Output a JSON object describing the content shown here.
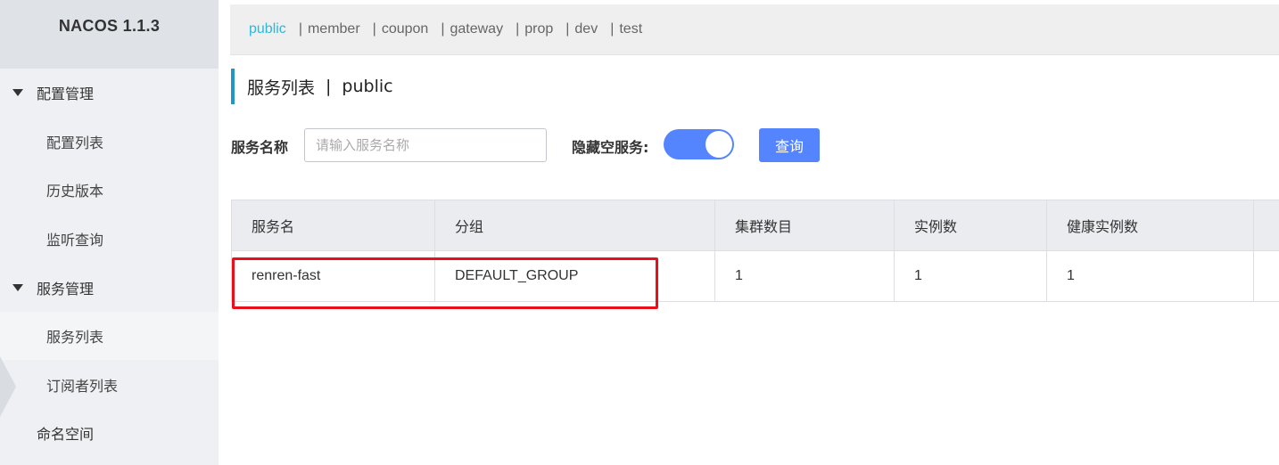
{
  "brand": {
    "title": "NACOS 1.1.3"
  },
  "sidebar": {
    "groups": [
      {
        "label": "配置管理",
        "items": [
          "配置列表",
          "历史版本",
          "监听查询"
        ]
      },
      {
        "label": "服务管理",
        "items": [
          "服务列表",
          "订阅者列表"
        ]
      }
    ],
    "plain_item": "命名空间",
    "active_item": "服务列表"
  },
  "namespaces": {
    "items": [
      "public",
      "member",
      "coupon",
      "gateway",
      "prop",
      "dev",
      "test"
    ],
    "separator": "|",
    "active": "public"
  },
  "page": {
    "title": "服务列表",
    "separator": "|",
    "namespace": "public"
  },
  "search": {
    "label": "服务名称",
    "placeholder": "请输入服务名称",
    "value": ""
  },
  "hide_empty": {
    "label": "隐藏空服务:",
    "enabled": true
  },
  "query_button": "查询",
  "table": {
    "headers": [
      "服务名",
      "分组",
      "集群数目",
      "实例数",
      "健康实例数",
      ""
    ],
    "rows": [
      [
        "renren-fast",
        "DEFAULT_GROUP",
        "1",
        "1",
        "1",
        ""
      ]
    ]
  },
  "colors": {
    "accent": "#5584ff",
    "active_namespace": "#2fb8d8",
    "highlight_box": "#e8111b",
    "title_bar": "#2196c7"
  }
}
